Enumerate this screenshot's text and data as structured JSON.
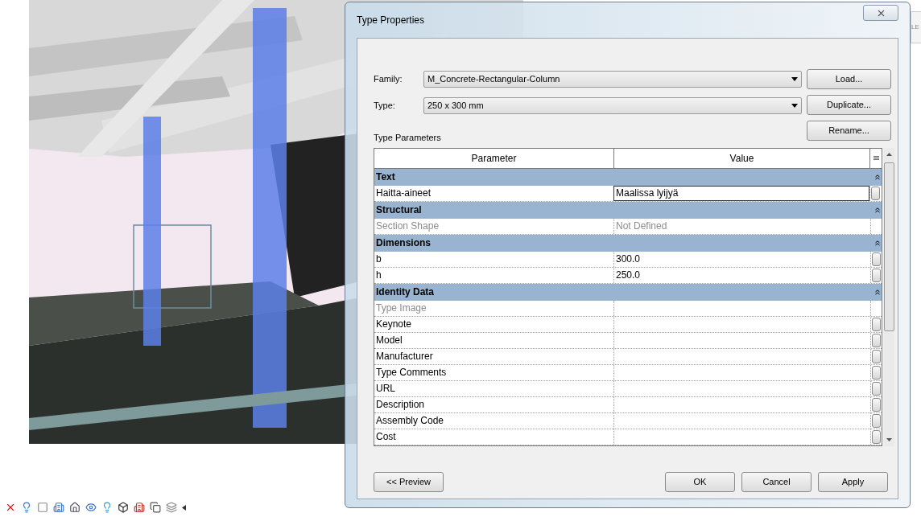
{
  "dialog": {
    "title": "Type Properties",
    "family": {
      "label": "Family:",
      "value": "M_Concrete-Rectangular-Column"
    },
    "type": {
      "label": "Type:",
      "value": "250 x 300 mm"
    },
    "side_buttons": [
      "Load...",
      "Duplicate...",
      "Rename..."
    ],
    "section_label": "Type Parameters",
    "table": {
      "columns": [
        "Parameter",
        "Value"
      ],
      "groups": [
        {
          "name": "Text",
          "expanded": true,
          "rows": [
            {
              "parameter": "Haitta-aineet",
              "value": "Maalissa lyijyä",
              "disabled": false,
              "selected": true
            }
          ]
        },
        {
          "name": "Structural",
          "expanded": true,
          "rows": [
            {
              "parameter": "Section Shape",
              "value": "Not Defined",
              "disabled": true,
              "selected": false
            }
          ]
        },
        {
          "name": "Dimensions",
          "expanded": true,
          "rows": [
            {
              "parameter": "b",
              "value": "300.0",
              "disabled": false,
              "selected": false
            },
            {
              "parameter": "h",
              "value": "250.0",
              "disabled": false,
              "selected": false
            }
          ]
        },
        {
          "name": "Identity Data",
          "expanded": true,
          "rows": [
            {
              "parameter": "Type Image",
              "disabled": true,
              "selected": false
            },
            {
              "parameter": "Keynote",
              "disabled": false,
              "selected": false
            },
            {
              "parameter": "Model",
              "disabled": false,
              "selected": false
            },
            {
              "parameter": "Manufacturer",
              "disabled": false,
              "selected": false
            },
            {
              "parameter": "Type Comments",
              "disabled": false,
              "selected": false
            },
            {
              "parameter": "URL",
              "disabled": false,
              "selected": false
            },
            {
              "parameter": "Description",
              "disabled": false,
              "selected": false
            },
            {
              "parameter": "Assembly Code",
              "disabled": false,
              "selected": false
            },
            {
              "parameter": "Cost",
              "disabled": false,
              "selected": false
            }
          ]
        }
      ]
    },
    "preview_button": "<< Preview",
    "buttons": [
      "OK",
      "Cancel",
      "Apply"
    ]
  },
  "background_label": "LE"
}
